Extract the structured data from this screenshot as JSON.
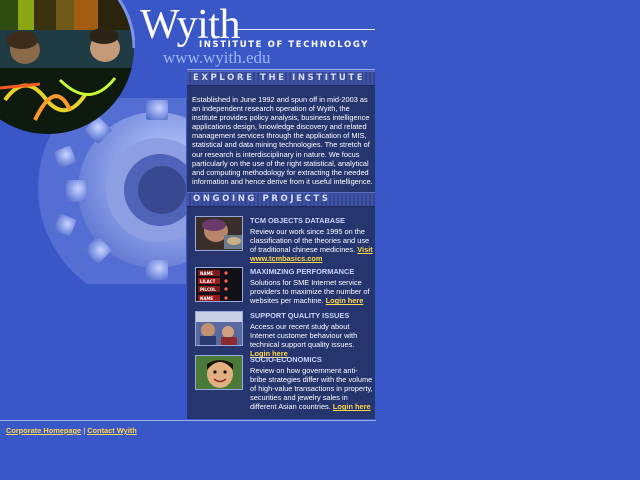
{
  "logo": {
    "name": "Wyith",
    "subtitle": "INSTITUTE OF TECHNOLOGY",
    "url": "www.wyith.edu"
  },
  "explore": {
    "title": "EXPLORE THE INSTITUTE",
    "text": "Established in June 1992 and spun off in mid-2003 as an independent research operation of Wyith, the institute provides policy analysis, business intelligence applications design, knowledge discovery and related management services through the application of MIS, statistical and data mining technologies. The stretch of our research is interdisciplinary in nature. We focus particularly on the use of the right statistical, analytical and computing methodology for extracting the needed information and hence derive from it useful intelligence."
  },
  "projects": {
    "title": "ONGOING PROJECTS",
    "items": [
      {
        "title": "TCM OBJECTS DATABASE",
        "desc": "Review our work since 1995 on the classification of the theories and use of traditional chinese medicines.",
        "link": "Visit www.tcmbasics.com"
      },
      {
        "title": "MAXIMIZING PERFORMANCE",
        "desc": "Solutions for SME Internet service providers to maximize the number of websites per machine.",
        "link": "Login here"
      },
      {
        "title": "SUPPORT QUALITY ISSUES",
        "desc": "Access our recent study about Internet customer behaviour with technical support quality issues.",
        "link": "Login here"
      },
      {
        "title": "SOCIO-ECONOMICS",
        "desc": "Review on how government anti-bribe strategies differ with the volume of high-value transactions in property, securities and jewelry sales in different Asian countries.",
        "link": "Login here"
      }
    ]
  },
  "thumbnail_labels": [
    "NAME",
    "LILACT",
    "PILCOL",
    "NAME"
  ],
  "footer": {
    "link1": "Corporate Homepage",
    "separator": "|",
    "link2": "Contact Wyith"
  },
  "colors": {
    "background": "#3a57c8",
    "panel": "#26356e",
    "link": "#ffd84a"
  }
}
